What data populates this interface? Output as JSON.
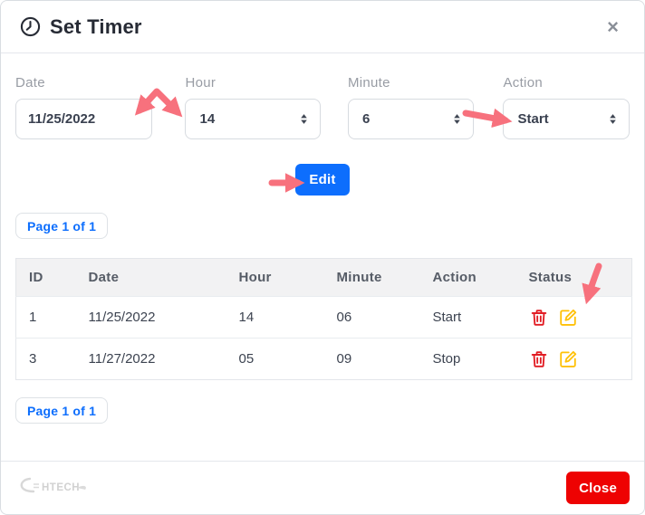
{
  "header": {
    "title": "Set Timer",
    "close_symbol": "×"
  },
  "form": {
    "date": {
      "label": "Date",
      "value": "11/25/2022"
    },
    "hour": {
      "label": "Hour",
      "value": "14"
    },
    "minute": {
      "label": "Minute",
      "value": "6"
    },
    "action": {
      "label": "Action",
      "value": "Start"
    },
    "edit_button": "Edit"
  },
  "pagination": {
    "top_label": "Page 1 of 1",
    "bottom_label": "Page 1 of 1"
  },
  "table": {
    "headers": [
      "ID",
      "Date",
      "Hour",
      "Minute",
      "Action",
      "Status"
    ],
    "rows": [
      {
        "id": "1",
        "date": "11/25/2022",
        "hour": "14",
        "minute": "06",
        "action": "Start"
      },
      {
        "id": "3",
        "date": "11/27/2022",
        "hour": "05",
        "minute": "09",
        "action": "Stop"
      }
    ]
  },
  "footer": {
    "logo_text": "HTECH",
    "close_button": "Close"
  },
  "colors": {
    "accent_blue": "#0d6efd",
    "close_red": "#ee0202",
    "arrow_pink": "#f7717d",
    "trash_red": "#e11b22",
    "edit_yellow": "#ffc107",
    "label_gray": "#989ca4",
    "header_bg": "#f2f2f3"
  },
  "icons": {
    "title": "clock-icon",
    "close": "close-icon",
    "selects": "up-down-spinner-icon",
    "delete": "trash-icon",
    "edit": "edit-pencil-square-icon"
  }
}
